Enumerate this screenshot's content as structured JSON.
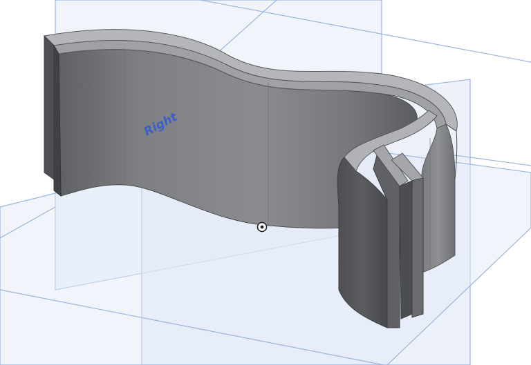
{
  "viewport": {
    "right_plane_label": "Right",
    "colors": {
      "plane_fill": "#dfe8f6",
      "plane_edge": "#8aaad6",
      "plane_label": "#3b5fc4",
      "part_light": "#8f9194",
      "part_mid": "#6e7073",
      "part_dark": "#4e5053",
      "part_top": "#b8babd",
      "origin": "#222222"
    },
    "icons": {
      "origin": "origin-icon"
    }
  }
}
